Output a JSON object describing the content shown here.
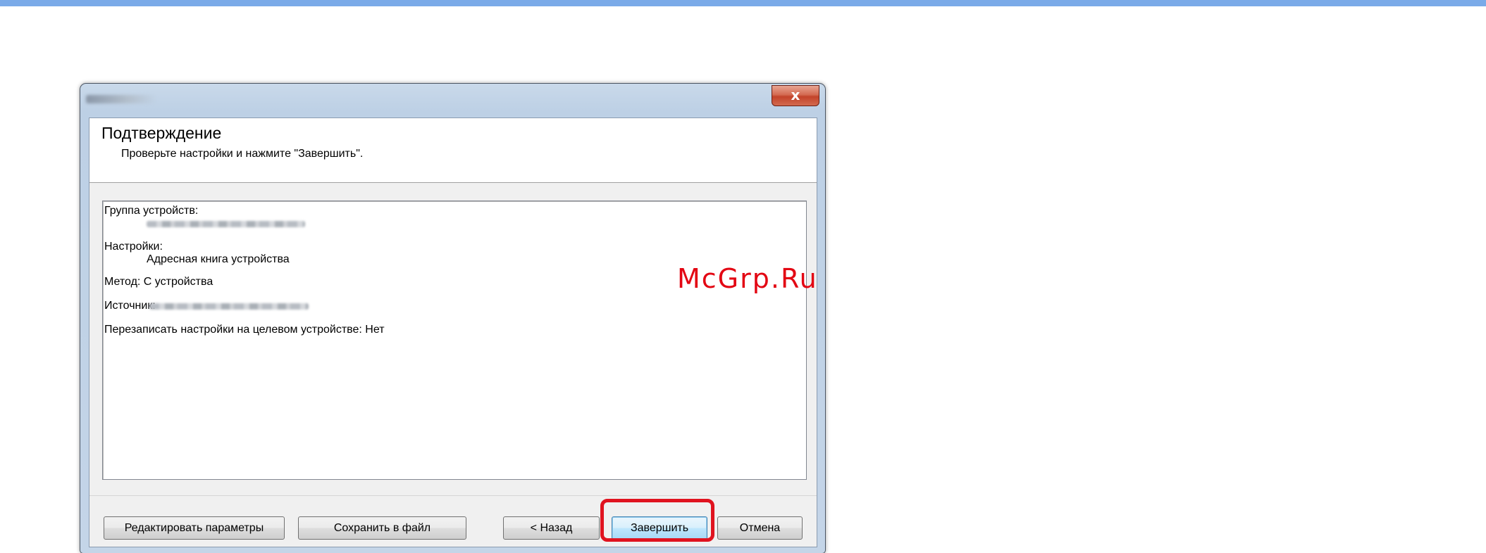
{
  "window": {
    "close_glyph": "x"
  },
  "header": {
    "title": "Подтверждение",
    "subtitle": "Проверьте настройки и нажмите \"Завершить\"."
  },
  "summary": {
    "group_label": "Группа устройств:",
    "settings_label": "Настройки:",
    "settings_value": "Адресная книга устройства",
    "method_line": "Метод: С устройства",
    "source_label": "Источник:",
    "overwrite_line": "Перезаписать настройки на целевом устройстве: Нет"
  },
  "buttons": {
    "edit": "Редактировать параметры",
    "save": "Сохранить в файл",
    "back": "< Назад",
    "finish": "Завершить",
    "cancel": "Отмена"
  },
  "watermark": "McGrp.Ru",
  "colors": {
    "highlight": "#e0131f",
    "watermark": "#e30613",
    "top_bar": "#7aaae8"
  }
}
